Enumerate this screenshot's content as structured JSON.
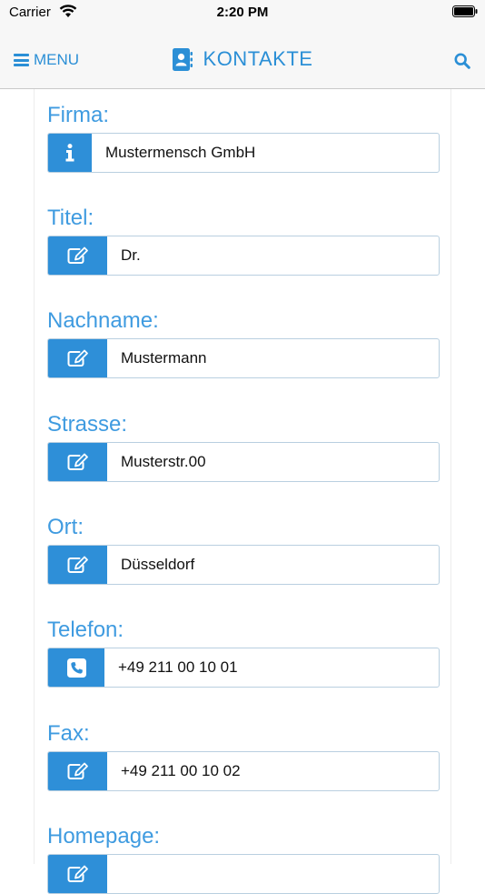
{
  "statusbar": {
    "carrier": "Carrier",
    "time": "2:20 PM"
  },
  "navbar": {
    "menu_label": "MENU",
    "title": "KONTAKTE"
  },
  "fields": [
    {
      "label": "Firma:",
      "value": "Mustermensch GmbH",
      "icon": "info-icon"
    },
    {
      "label": "Titel:",
      "value": "Dr.",
      "icon": "edit-icon"
    },
    {
      "label": "Nachname:",
      "value": "Mustermann",
      "icon": "edit-icon"
    },
    {
      "label": "Strasse:",
      "value": "Musterstr.00",
      "icon": "edit-icon"
    },
    {
      "label": "Ort:",
      "value": "Düsseldorf",
      "icon": "edit-icon"
    },
    {
      "label": "Telefon:",
      "value": "+49 211 00 10 01",
      "icon": "phone-icon"
    },
    {
      "label": "Fax:",
      "value": "+49 211 00 10 02",
      "icon": "edit-icon"
    },
    {
      "label": "Homepage:",
      "value": "",
      "icon": "edit-icon"
    }
  ],
  "colors": {
    "accent": "#2e8fd8",
    "label": "#3f9be0",
    "navbar_bg": "#f7f7f7"
  }
}
